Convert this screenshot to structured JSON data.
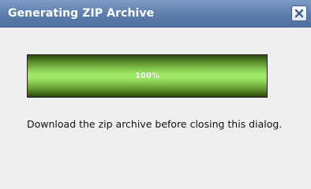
{
  "dialog": {
    "title": "Generating ZIP Archive",
    "close_icon": "close-icon",
    "accent_color": "#5e7fae"
  },
  "progress": {
    "percent": 100,
    "label": "100%",
    "fill_color": "#9ee566"
  },
  "message": "Download the zip archive before closing this dialog."
}
